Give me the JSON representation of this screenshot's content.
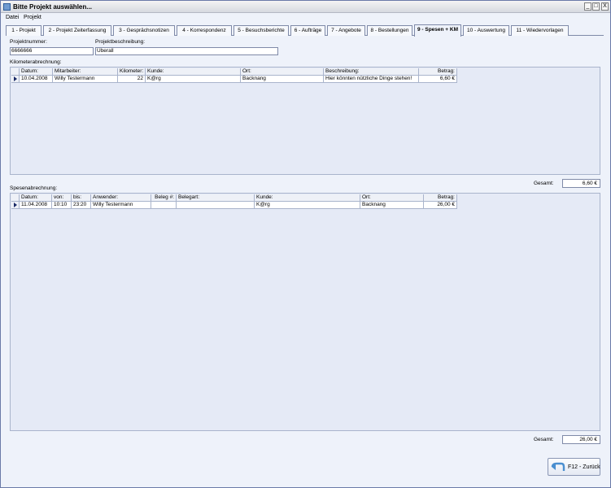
{
  "window": {
    "title": "Bitte Projekt auswählen...",
    "controls": {
      "minimize": "_",
      "maximize": "□",
      "close": "X"
    }
  },
  "menu": [
    {
      "label": "Datei"
    },
    {
      "label": "Projekt"
    }
  ],
  "tabs": [
    {
      "label": "1 - Projekt"
    },
    {
      "label": "2 - Projekt Zeiterfassung"
    },
    {
      "label": "3 - Gesprächsnotizen"
    },
    {
      "label": "4 - Korrespondenz"
    },
    {
      "label": "5 - Besuchsberichte"
    },
    {
      "label": "6 - Aufträge"
    },
    {
      "label": "7 - Angebote"
    },
    {
      "label": "8 - Bestellungen"
    },
    {
      "label": "9 - Spesen + KM",
      "active": true
    },
    {
      "label": "10 - Auswertung"
    },
    {
      "label": "11 - Wiedervorlagen"
    }
  ],
  "project": {
    "number_label": "Projektnummer:",
    "number_value": "6666666",
    "description_label": "Projektbeschreibung:",
    "description_value": "Überall"
  },
  "km": {
    "section_label": "Kilometerabrechnung:",
    "columns": [
      "Datum:",
      "Mitarbeiter:",
      "Kilometer:",
      "Kunde:",
      "Ort:",
      "Beschreibung:",
      "Betrag:"
    ],
    "rows": [
      [
        "10.04.2008",
        "Willy Testermann",
        "22",
        "K@rg",
        "Backnang",
        "Hier könnten nützliche Dinge stehen!",
        "6,60 €"
      ]
    ],
    "total_label": "Gesamt:",
    "total_value": "6,60 €"
  },
  "spesen": {
    "section_label": "Spesenabrechnung:",
    "columns": [
      "Datum:",
      "von:",
      "bis:",
      "Anwender:",
      "Beleg #:",
      "Belegart:",
      "Kunde:",
      "Ort:",
      "Betrag:"
    ],
    "rows": [
      [
        "11.04.2008",
        "10:10",
        "23:20",
        "Willy Testermann",
        "",
        "",
        "K@rg",
        "Backnang",
        "26,00 €"
      ]
    ],
    "total_label": "Gesamt:",
    "total_value": "26,00 €"
  },
  "back_button": {
    "label": "F12 - Zurück"
  },
  "colors": {
    "accent": "#1a2a66",
    "window_bg": "#eef2fa",
    "grid_bg": "#e5eaf6"
  }
}
